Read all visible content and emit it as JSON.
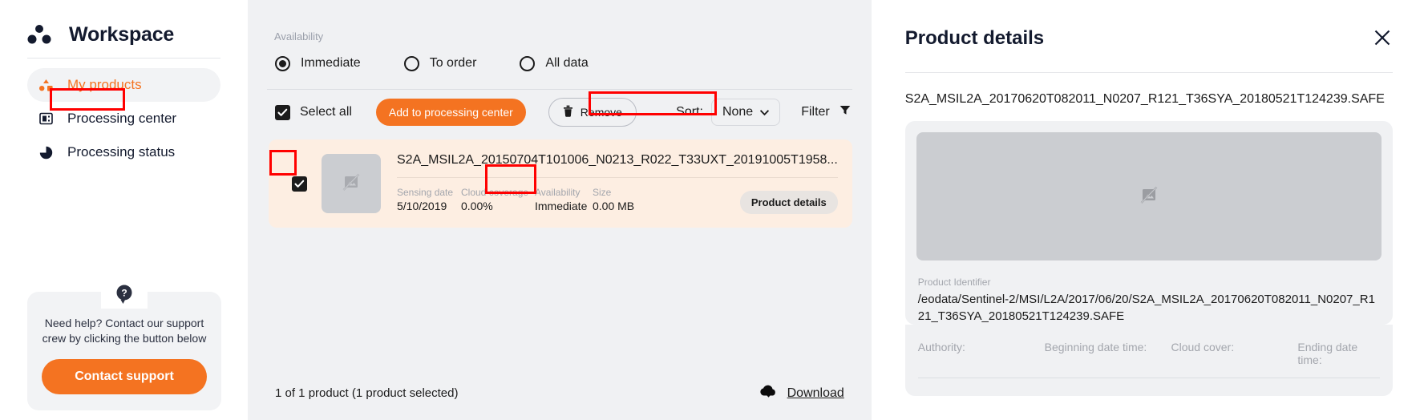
{
  "sidebar": {
    "brand": {
      "title": "Workspace",
      "logo_icon": "three-dots-logo"
    },
    "items": [
      {
        "label": "My products",
        "icon": "shapes-icon",
        "active": true,
        "highlighted": true
      },
      {
        "label": "Processing center",
        "icon": "server-icon",
        "active": false,
        "highlighted": false
      },
      {
        "label": "Processing status",
        "icon": "pie-chart-icon",
        "active": false,
        "highlighted": false
      }
    ],
    "help": {
      "icon": "question-mark-icon",
      "text": "Need help? Contact our support crew by clicking the button below",
      "button_label": "Contact support"
    }
  },
  "center": {
    "availability": {
      "label": "Availability",
      "options": [
        {
          "label": "Immediate",
          "selected": true
        },
        {
          "label": "To order",
          "selected": false
        },
        {
          "label": "All data",
          "selected": false
        }
      ]
    },
    "toolbar": {
      "select_all_label": "Select all",
      "select_all_checked": true,
      "add_to_processing_label": "Add to processing center",
      "add_to_processing_highlighted": true,
      "remove_label": "Remove",
      "remove_icon": "trash-icon",
      "sort_label": "Sort:",
      "sort_value": "None",
      "sort_caret_icon": "chevron-down-icon",
      "filter_label": "Filter",
      "filter_icon": "funnel-icon"
    },
    "product": {
      "checked": true,
      "checkbox_highlighted": true,
      "thumbnail_icon": "broken-image-icon",
      "title": "S2A_MSIL2A_20150704T101006_N0213_R022_T33UXT_20191005T1958...",
      "meta": [
        {
          "key": "Sensing date",
          "value": "5/10/2019",
          "highlighted": false
        },
        {
          "key": "Cloud coverage",
          "value": "0.00%",
          "highlighted": false
        },
        {
          "key": "Availability",
          "value": "Immediate",
          "highlighted": true
        },
        {
          "key": "Size",
          "value": "0.00 MB",
          "highlighted": false
        }
      ],
      "details_chip_label": "Product details"
    },
    "footer": {
      "count_text": "1 of 1 product (1 product selected)",
      "download_label": "Download",
      "download_icon": "cloud-download-icon"
    }
  },
  "details": {
    "title": "Product details",
    "close_icon": "close-icon",
    "product_name": "S2A_MSIL2A_20170620T082011_N0207_R121_T36SYA_20180521T124239.SAFE",
    "preview_icon": "broken-image-icon",
    "identifier_key": "Product Identifier",
    "identifier_value": "/eodata/Sentinel-2/MSI/L2A/2017/06/20/S2A_MSIL2A_20170620T082011_N0207_R121_T36SYA_20180521T124239.SAFE",
    "attributes": [
      {
        "key": "Authority:"
      },
      {
        "key": "Beginning date time:"
      },
      {
        "key": "Cloud cover:"
      },
      {
        "key": "Ending date time:"
      }
    ]
  },
  "colors": {
    "accent": "#f47321",
    "highlight": "#ff0000",
    "card_bg": "#fdeee2",
    "panel_bg": "#f0f1f3",
    "text": "#1b1b1b",
    "muted": "#a3a6ad",
    "brand_text": "#131a2e"
  }
}
